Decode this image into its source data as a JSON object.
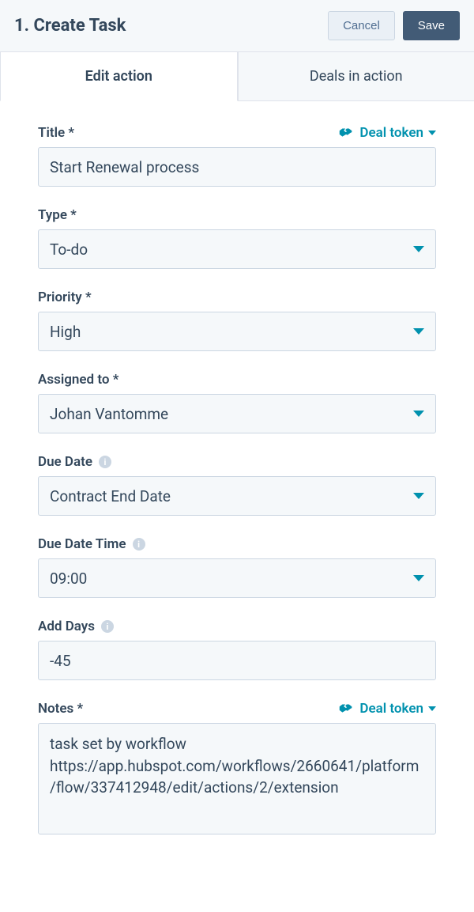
{
  "header": {
    "title": "1. Create Task",
    "cancel": "Cancel",
    "save": "Save"
  },
  "tabs": {
    "edit": "Edit action",
    "deals": "Deals in action"
  },
  "tokenLink": "Deal token",
  "fields": {
    "title": {
      "label": "Title *",
      "value": "Start Renewal process"
    },
    "type": {
      "label": "Type *",
      "value": "To-do"
    },
    "priority": {
      "label": "Priority *",
      "value": "High"
    },
    "assigned": {
      "label": "Assigned to *",
      "value": "Johan Vantomme"
    },
    "dueDate": {
      "label": "Due Date",
      "value": "Contract End Date"
    },
    "dueTime": {
      "label": "Due Date Time",
      "value": "09:00"
    },
    "addDays": {
      "label": "Add Days",
      "value": "-45"
    },
    "notes": {
      "label": "Notes *",
      "value": "task set by workflow https://app.hubspot.com/workflows/2660641/platform/flow/337412948/edit/actions/2/extension"
    }
  }
}
